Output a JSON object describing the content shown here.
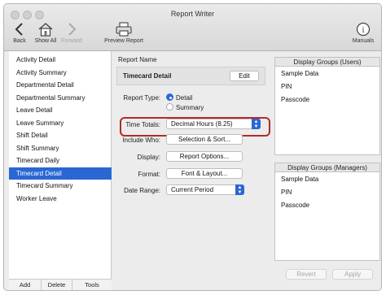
{
  "window": {
    "title": "Report Writer"
  },
  "toolbar": {
    "back": "Back",
    "show_all": "Show All",
    "forward": "Forward",
    "preview": "Preview Report",
    "manuals": "Manuals"
  },
  "sidebar": {
    "items": [
      "Activity Detail",
      "Activity Summary",
      "Departmental Detail",
      "Departmental Summary",
      "Leave Detail",
      "Leave Summary",
      "Shift Detail",
      "Shift Summary",
      "Timecard Daily",
      "Timecard Detail",
      "Timecard Summary",
      "Worker Leave"
    ],
    "selected": "Timecard Detail",
    "buttons": {
      "add": "Add",
      "delete": "Delete",
      "tools": "Tools"
    }
  },
  "report": {
    "name_label": "Report Name",
    "name_value": "Timecard Detail",
    "edit_button": "Edit",
    "type_label": "Report Type:",
    "type_options": [
      "Detail",
      "Summary"
    ],
    "type_selected": "Detail",
    "time_totals_label": "Time Totals:",
    "time_totals_value": "Decimal Hours (8.25)",
    "include_label": "Include Who:",
    "include_button": "Selection & Sort...",
    "display_label": "Display:",
    "display_button": "Report Options...",
    "format_label": "Format:",
    "format_button": "Font & Layout...",
    "date_range_label": "Date Range:",
    "date_range_value": "Current Period"
  },
  "groups_users": {
    "title": "Display Groups (Users)",
    "items": [
      "Sample Data",
      "PIN",
      "Passcode"
    ]
  },
  "groups_managers": {
    "title": "Display Groups (Managers)",
    "items": [
      "Sample Data",
      "PIN",
      "Passcode"
    ]
  },
  "footer": {
    "revert": "Revert",
    "apply": "Apply"
  },
  "colors": {
    "accent": "#2a67d3",
    "highlight_border": "#b22a2a"
  },
  "icons": {
    "back": "chevron-left-icon",
    "show_all": "house-icon",
    "forward": "chevron-right-icon",
    "preview": "printer-icon",
    "manuals": "info-icon"
  }
}
